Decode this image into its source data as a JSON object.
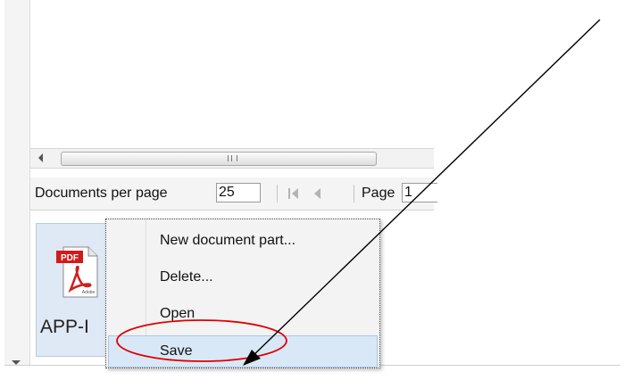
{
  "scrollbar": {
    "thumb_grip": "III"
  },
  "toolbar": {
    "documents_per_page_label": "Documents per page",
    "documents_per_page_value": "25",
    "page_label": "Page",
    "page_value": "1"
  },
  "document": {
    "name": "APP-I",
    "icon": "pdf-icon",
    "icon_badge": "PDF",
    "icon_brand": "Adobe"
  },
  "context_menu": {
    "items": [
      {
        "label": "New document part..."
      },
      {
        "label": "Delete..."
      },
      {
        "label": "Open"
      },
      {
        "label": "Save",
        "highlighted": true
      }
    ]
  },
  "annotation": {
    "arrow_color": "#000000",
    "ellipse_color": "#e00000"
  },
  "colors": {
    "menu_highlight": "#d9e8f6",
    "tile_selected": "#dfe8f5"
  }
}
